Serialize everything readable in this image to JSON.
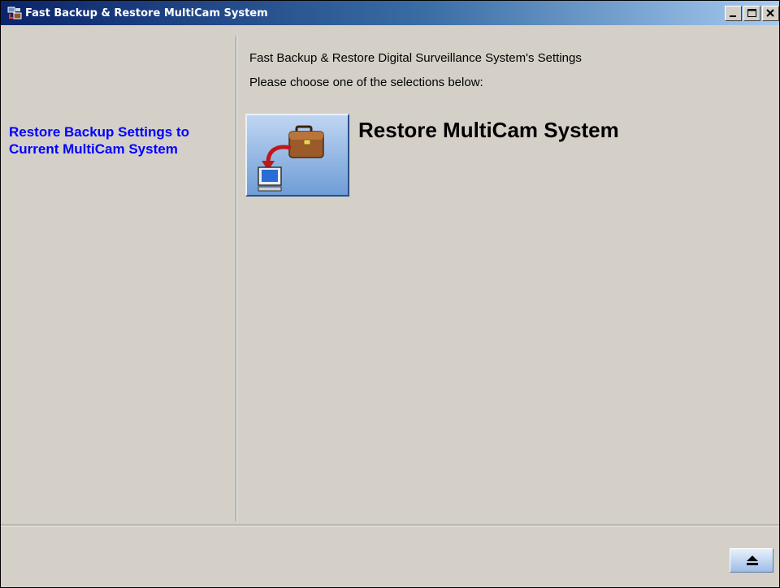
{
  "window": {
    "title": "Fast Backup & Restore MultiCam System",
    "controls": [
      "minimize-icon",
      "maximize-icon",
      "close-icon"
    ]
  },
  "sidebar": {
    "link_label": "Restore Backup Settings to Current MultiCam System",
    "link_color": "#0000ff"
  },
  "main": {
    "header": "Fast Backup & Restore Digital Surveillance System's Settings",
    "instruction": "Please choose one of the selections below:",
    "option": {
      "label": "Restore MultiCam System",
      "icon": "computer-briefcase-restore-icon"
    }
  },
  "footer": {
    "eject_icon": "eject-icon"
  },
  "colors": {
    "titlebar_start": "#0a246a",
    "titlebar_end": "#a6caf0",
    "window_bg": "#d4d0c8"
  }
}
